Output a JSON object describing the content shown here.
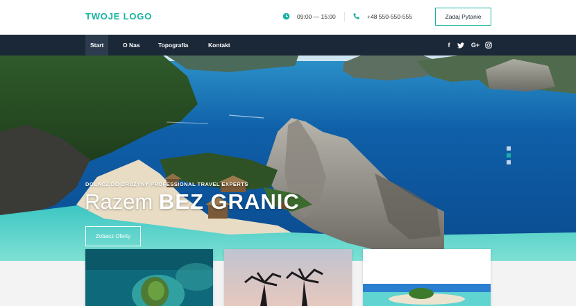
{
  "header": {
    "logo": "TWOJE LOGO",
    "hours": "09:00 — 15:00",
    "phone": "+48 550-550-555",
    "ask_button": "Zadaj Pytanie",
    "icons": {
      "hours": "clock-icon",
      "phone": "phone-icon"
    }
  },
  "nav": {
    "items": [
      {
        "label": "Start",
        "active": true
      },
      {
        "label": "O Nas",
        "active": false
      },
      {
        "label": "Topografia",
        "active": false
      },
      {
        "label": "Kontakt",
        "active": false
      }
    ],
    "social": [
      {
        "icon": "facebook-icon",
        "glyph": "f"
      },
      {
        "icon": "twitter-icon",
        "glyph": "t"
      },
      {
        "icon": "google-plus-icon",
        "glyph": "G+"
      },
      {
        "icon": "instagram-icon",
        "glyph": "◎"
      }
    ]
  },
  "hero": {
    "subtitle": "DOŁĄCZ DO DRUŻYNY PROFESSIONAL TRAVEL EXPERTS",
    "title_light": "Razem",
    "title_bold": "BEZ GRANIC",
    "button": "Zobacz Oferty",
    "slider_active_index": 1,
    "slider_count": 3
  },
  "cards": [
    {
      "image": "aerial-island-photo"
    },
    {
      "image": "palm-trees-sunset-photo"
    },
    {
      "image": "tropical-beach-photo"
    }
  ],
  "colors": {
    "accent": "#16b3a0",
    "nav_bg": "#1b2838",
    "nav_active": "#2c3b4d",
    "band_bg": "#f3f3f3"
  }
}
